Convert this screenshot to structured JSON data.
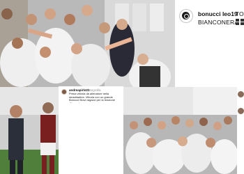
{
  "top_post": {
    "username": "bonucci leo19",
    "caption_line1": "TO",
    "caption_line2": "BIANCONERA",
    "icons": {
      "avatar": "juventus-logo-avatar",
      "flag": "italy-flag-icon"
    }
  },
  "bottom_post": {
    "username": "andreapirlo21",
    "time": "1 fotografia",
    "caption": "Prima vittoria da allenatore nella stracittadina. Vittoria con un grande Bonucci Bravi ragazzi per la reazione @juventus"
  },
  "colors": {
    "jersey_white": "#f2f2f2",
    "locker_gray": "#c9c9c9",
    "torino_red": "#7a1f1f",
    "pitch_green": "#4f7f3a"
  }
}
